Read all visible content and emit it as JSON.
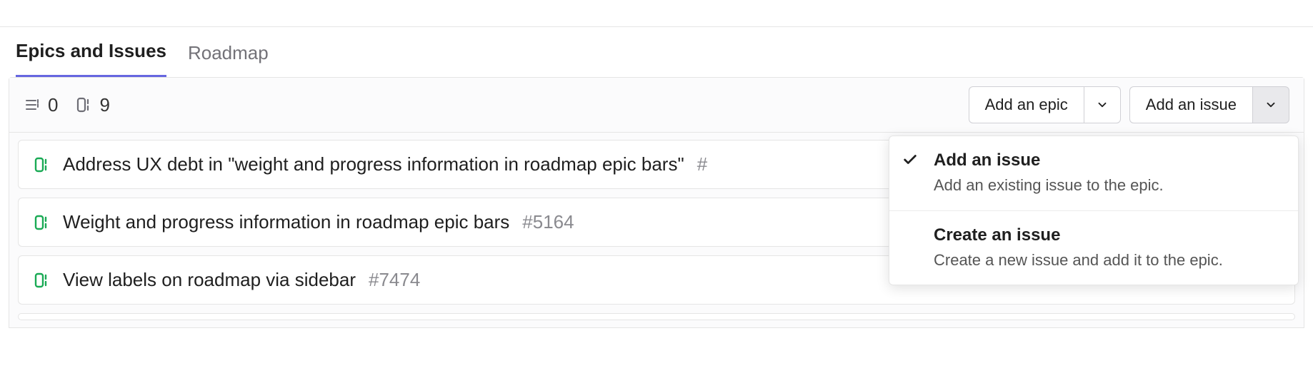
{
  "tabs": {
    "epics_issues": "Epics and Issues",
    "roadmap": "Roadmap"
  },
  "counts": {
    "epics": "0",
    "issues": "9"
  },
  "buttons": {
    "add_epic": "Add an epic",
    "add_issue": "Add an issue"
  },
  "rows": [
    {
      "title": "Address UX debt in \"weight and progress information in roadmap epic bars\"",
      "ref": "#"
    },
    {
      "title": "Weight and progress information in roadmap epic bars",
      "ref": "#5164"
    },
    {
      "title": "View labels on roadmap via sidebar",
      "ref": "#7474"
    }
  ],
  "dropdown": {
    "add_issue": {
      "title": "Add an issue",
      "desc": "Add an existing issue to the epic."
    },
    "create_issue": {
      "title": "Create an issue",
      "desc": "Create a new issue and add it to the epic."
    }
  }
}
